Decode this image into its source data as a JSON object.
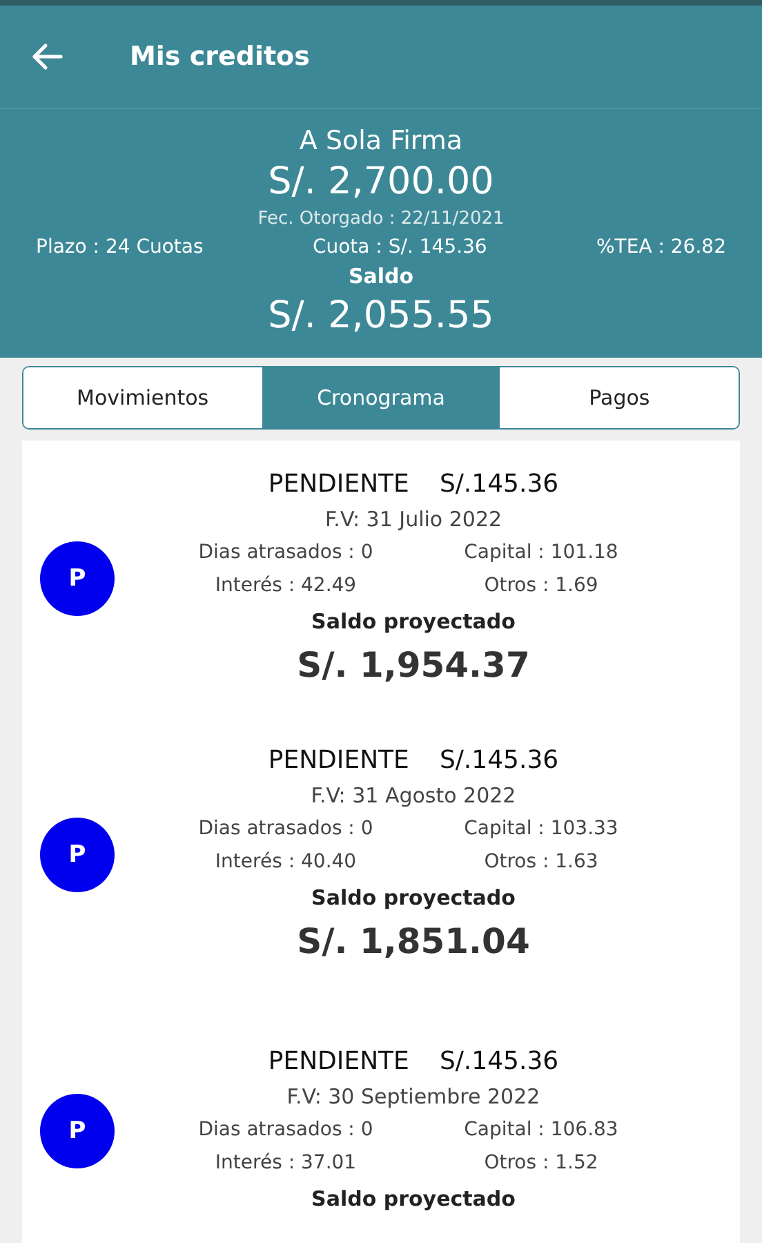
{
  "app_bar": {
    "title": "Mis creditos"
  },
  "summary": {
    "product": "A Sola Firma",
    "amount": "S/. 2,700.00",
    "granted": "Fec. Otorgado : 22/11/2021",
    "details": [
      "Plazo : 24 Cuotas",
      "Cuota : S/. 145.36",
      "%TEA : 26.82"
    ],
    "balance_label": "Saldo",
    "balance": "S/. 2,055.55"
  },
  "tabs": [
    {
      "label": "Movimientos",
      "selected": false
    },
    {
      "label": "Cronograma",
      "selected": true
    },
    {
      "label": "Pagos",
      "selected": false
    }
  ],
  "installments": [
    {
      "badge": "P",
      "status": "PENDIENTE",
      "amount": "S/.145.36",
      "due": "F.V: 31 Julio 2022",
      "days_late": "Dias atrasados : 0",
      "capital": "Capital : 101.18",
      "interest": "Interés : 42.49",
      "other": "Otros : 1.69",
      "projected_label": "Saldo proyectado",
      "projected": "S/. 1,954.37"
    },
    {
      "badge": "P",
      "status": "PENDIENTE",
      "amount": "S/.145.36",
      "due": "F.V: 31 Agosto 2022",
      "days_late": "Dias atrasados : 0",
      "capital": "Capital : 103.33",
      "interest": "Interés : 40.40",
      "other": "Otros : 1.63",
      "projected_label": "Saldo proyectado",
      "projected": "S/. 1,851.04"
    },
    {
      "badge": "P",
      "status": "PENDIENTE",
      "amount": "S/.145.36",
      "due": "F.V: 30 Septiembre 2022",
      "days_late": "Dias atrasados : 0",
      "capital": "Capital : 106.83",
      "interest": "Interés : 37.01",
      "other": "Otros : 1.52",
      "projected_label": "Saldo proyectado"
    }
  ]
}
